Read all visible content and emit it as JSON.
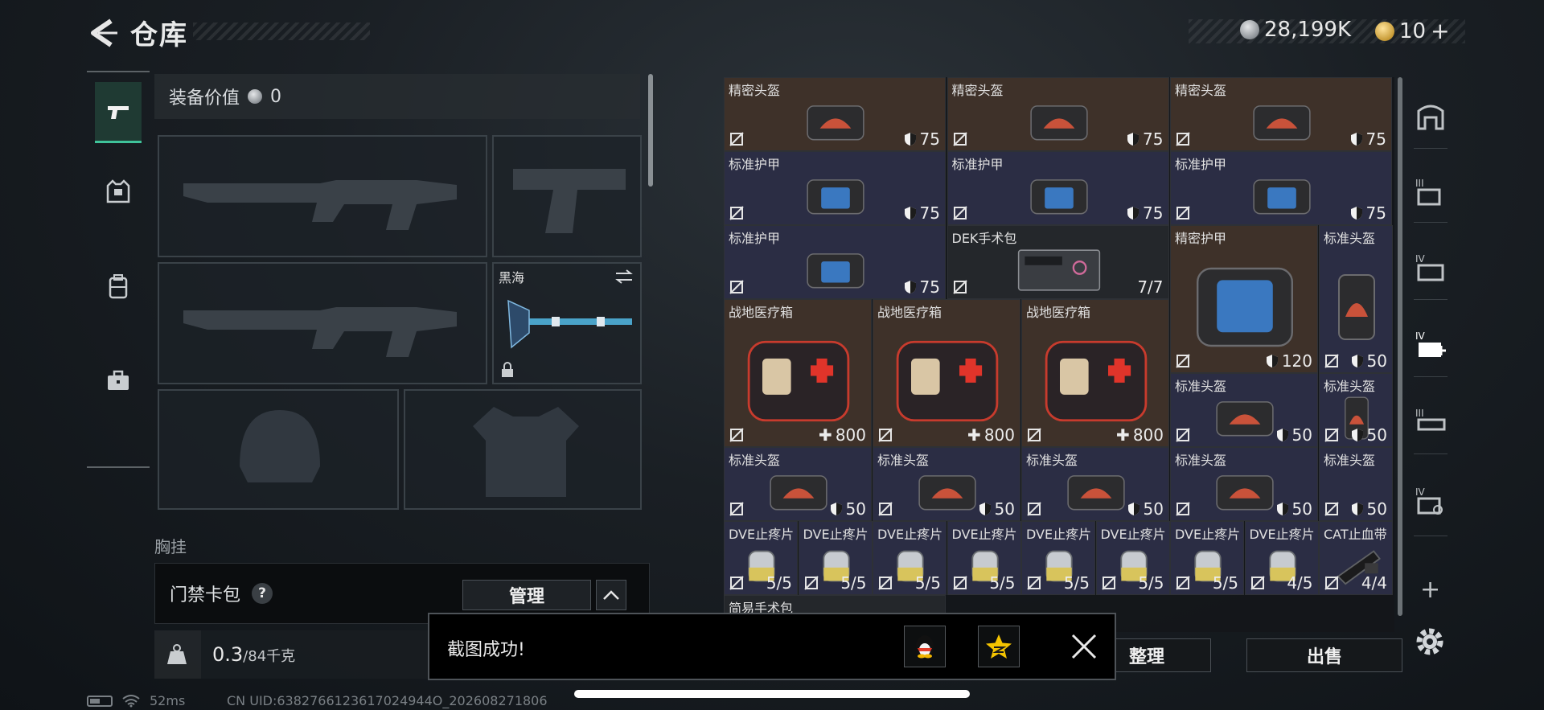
{
  "header": {
    "title": "仓库",
    "currency_silver": "28,199K",
    "currency_gold": "10"
  },
  "left_panel": {
    "equip_value_label": "装备价值",
    "equip_value": "0",
    "melee_slot_name": "黑海",
    "chest_rig_label": "胸挂",
    "key_card_label": "门禁卡包",
    "help_symbol": "?",
    "manage_button": "管理",
    "weight_value": "0.3",
    "weight_capacity": "/84千克"
  },
  "status_bar": {
    "ping": "52ms",
    "uid": "CN UID:6382766123617024944O_202608271806"
  },
  "inventory": {
    "cells": [
      {
        "name": "精密头盔",
        "value": "75",
        "type": "shield"
      },
      {
        "name": "精密头盔",
        "value": "75",
        "type": "shield"
      },
      {
        "name": "精密头盔",
        "value": "75",
        "type": "shield"
      },
      {
        "name": "标准护甲",
        "value": "75",
        "type": "shield"
      },
      {
        "name": "标准护甲",
        "value": "75",
        "type": "shield"
      },
      {
        "name": "标准护甲",
        "value": "75",
        "type": "shield"
      },
      {
        "name": "标准护甲",
        "value": "75",
        "type": "shield"
      },
      {
        "name": "DEK手术包",
        "value": "7/7",
        "type": "count"
      },
      {
        "name": "精密护甲",
        "value": "120",
        "type": "shield"
      },
      {
        "name": "标准头盔",
        "value": "50",
        "type": "shield"
      },
      {
        "name": "战地医疗箱",
        "value": "800",
        "type": "heal"
      },
      {
        "name": "战地医疗箱",
        "value": "800",
        "type": "heal"
      },
      {
        "name": "战地医疗箱",
        "value": "800",
        "type": "heal"
      },
      {
        "name": "标准头盔",
        "value": "50",
        "type": "shield"
      },
      {
        "name": "标准头盔",
        "value": "50",
        "type": "shield"
      },
      {
        "name": "标准头盔",
        "value": "50",
        "type": "shield"
      },
      {
        "name": "标准头盔",
        "value": "50",
        "type": "shield"
      },
      {
        "name": "标准头盔",
        "value": "50",
        "type": "shield"
      },
      {
        "name": "标准头盔",
        "value": "50",
        "type": "shield"
      },
      {
        "name": "标准头盔",
        "value": "50",
        "type": "shield"
      },
      {
        "name": "DVE止疼片",
        "value": "5/5",
        "type": "count"
      },
      {
        "name": "DVE止疼片",
        "value": "5/5",
        "type": "count"
      },
      {
        "name": "DVE止疼片",
        "value": "5/5",
        "type": "count"
      },
      {
        "name": "DVE止疼片",
        "value": "5/5",
        "type": "count"
      },
      {
        "name": "DVE止疼片",
        "value": "5/5",
        "type": "count"
      },
      {
        "name": "DVE止疼片",
        "value": "5/5",
        "type": "count"
      },
      {
        "name": "DVE止疼片",
        "value": "5/5",
        "type": "count"
      },
      {
        "name": "DVE止疼片",
        "value": "4/5",
        "type": "count"
      },
      {
        "name": "CAT止血带",
        "value": "4/4",
        "type": "count"
      },
      {
        "name": "简易手术包",
        "value": "",
        "type": "none"
      }
    ]
  },
  "actions": {
    "sort_button": "整理",
    "sell_button": "出售"
  },
  "toast": {
    "message": "截图成功!"
  },
  "colors": {
    "accent_green": "#3fc39a",
    "rarity_brown": "#3e3129",
    "rarity_blue": "#2b2d44"
  }
}
